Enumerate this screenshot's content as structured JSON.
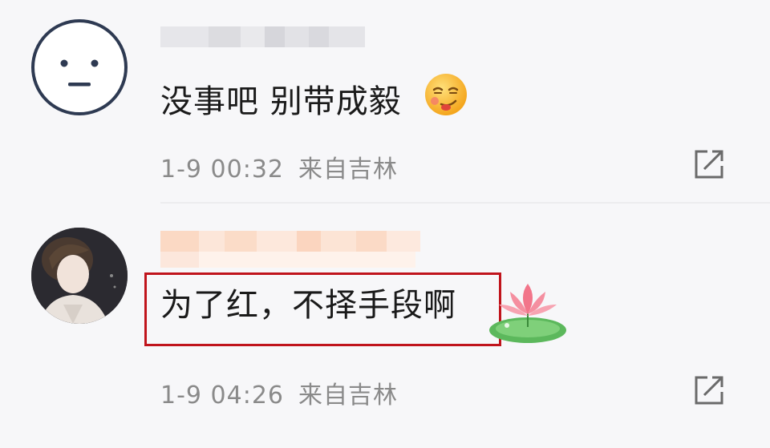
{
  "comments": [
    {
      "avatar": "neutral-face-avatar",
      "text": "没事吧 别带成毅",
      "emoji": "smirk-emoji",
      "time": "1-9 00:32",
      "location": "来自吉林",
      "share_icon": "share-icon"
    },
    {
      "avatar": "user-photo-avatar",
      "text": "为了红，不择手段啊",
      "emoji": "lotus-emoji",
      "time": "1-9 04:26",
      "location": "来自吉林",
      "share_icon": "share-icon"
    }
  ],
  "colors": {
    "background": "#f7f7f9",
    "text": "#1a1a1a",
    "meta": "#8a8a8a",
    "highlight": "#c0141c"
  }
}
